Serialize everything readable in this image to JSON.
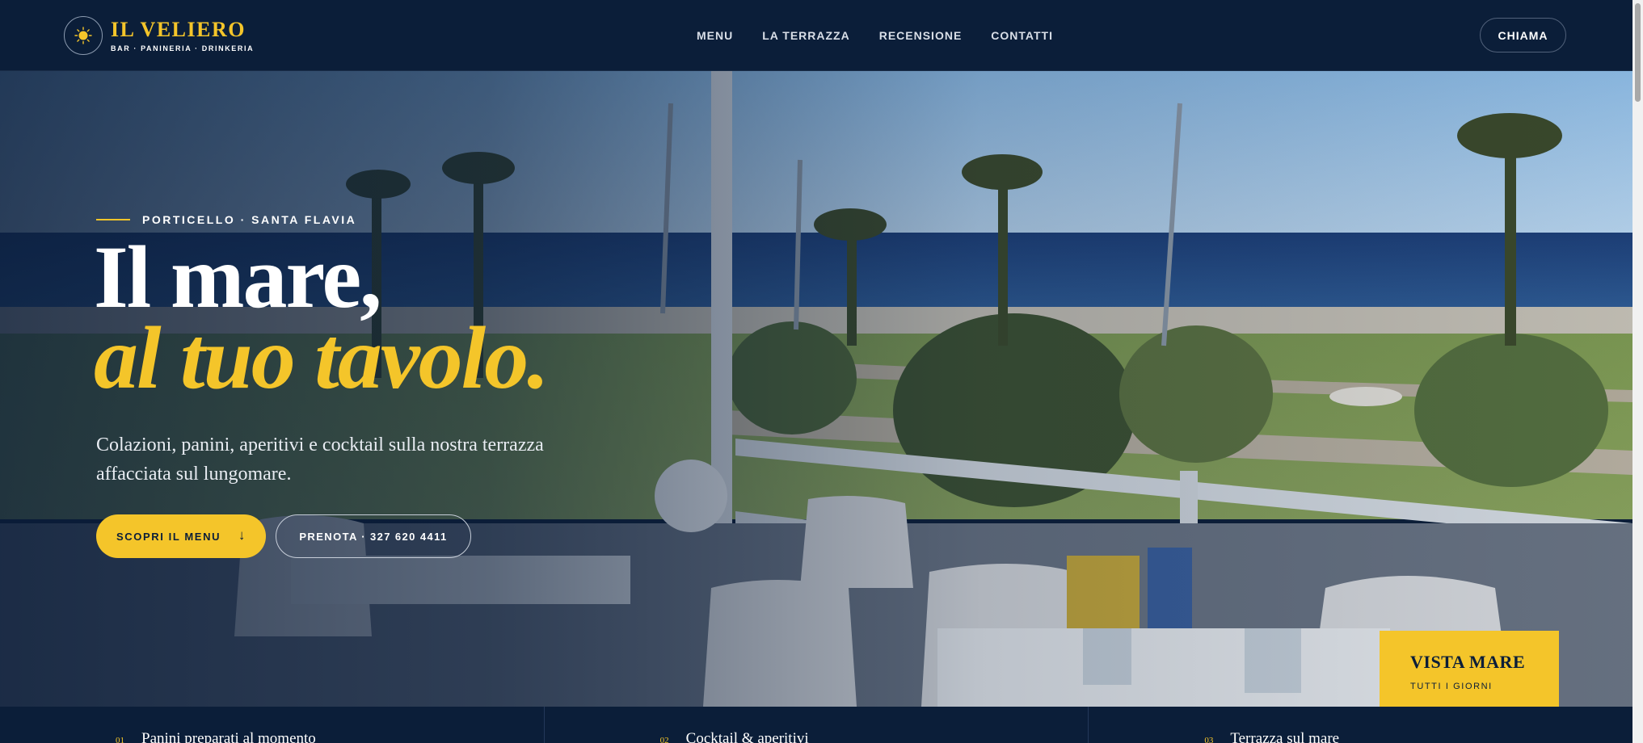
{
  "brand": {
    "name": "IL VELIERO",
    "tagline": "BAR · PANINERIA · DRINKERIA",
    "logo_icon": "sun-icon"
  },
  "nav": {
    "items": [
      {
        "label": "MENU"
      },
      {
        "label": "LA TERRAZZA"
      },
      {
        "label": "RECENSIONE"
      },
      {
        "label": "CONTATTI"
      }
    ],
    "call_label": "CHIAMA"
  },
  "hero": {
    "eyebrow": "PORTICELLO · SANTA FLAVIA",
    "title_line1": "Il mare,",
    "title_line2": "al tuo tavolo.",
    "subtitle": "Colazioni, panini, aperitivi e cocktail sulla nostra terrazza affacciata sul lungomare.",
    "primary_cta": "SCOPRI IL MENU",
    "primary_cta_icon": "arrow-down-icon",
    "secondary_cta": "PRENOTA · 327 620 4411",
    "badge_title": "VISTA MARE",
    "badge_subtitle": "TUTTI I GIORNI"
  },
  "features": [
    {
      "num": "01",
      "title": "Panini preparati al momento"
    },
    {
      "num": "02",
      "title": "Cocktail & aperitivi"
    },
    {
      "num": "03",
      "title": "Terrazza sul mare"
    }
  ],
  "colors": {
    "navy": "#0b1e39",
    "accent_yellow": "#f4c52a",
    "text_white": "#ffffff"
  }
}
